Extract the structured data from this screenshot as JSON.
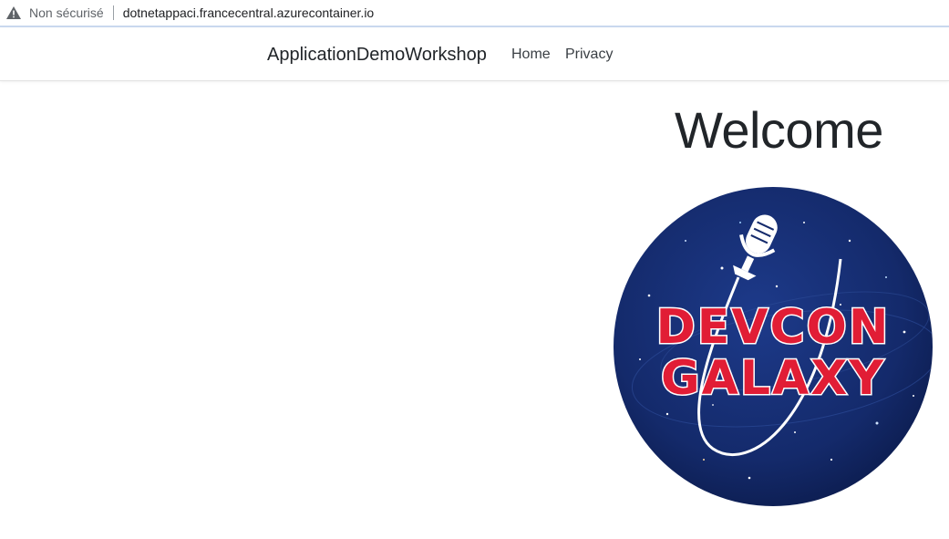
{
  "browser": {
    "security_label": "Non sécurisé",
    "url": "dotnetappaci.francecentral.azurecontainer.io",
    "security_icon": "warning-triangle-icon"
  },
  "navbar": {
    "brand": "ApplicationDemoWorkshop",
    "links": [
      {
        "label": "Home"
      },
      {
        "label": "Privacy"
      }
    ]
  },
  "main": {
    "heading": "Welcome",
    "logo": {
      "line1": "DEVCON",
      "line2": "GALAXY",
      "icon": "microphone-icon",
      "colors": {
        "background": "#142a6b",
        "text_fill": "#e11d35",
        "text_stroke": "#ffffff"
      }
    }
  }
}
